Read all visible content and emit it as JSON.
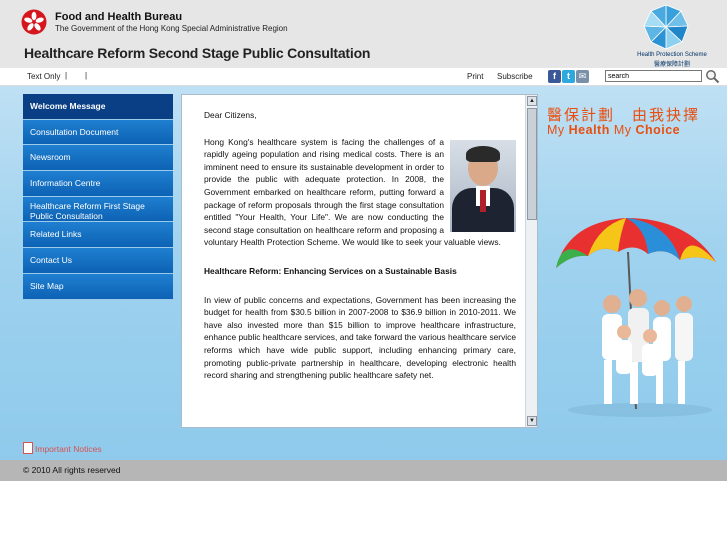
{
  "header": {
    "bureau_name": "Food and Health Bureau",
    "bureau_subtitle": "The Government of the Hong Kong Special Administrative Region",
    "page_title": "Healthcare Reform Second Stage Public Consultation",
    "scheme_name_en": "Health Protection Scheme",
    "scheme_name_zh": "醫療保障計劃"
  },
  "utility": {
    "text_only": "Text Only",
    "separator": "|",
    "print": "Print",
    "subscribe": "Subscribe",
    "search_value": "search",
    "social_icons": [
      "facebook-icon",
      "twitter-icon",
      "email-icon"
    ]
  },
  "nav": {
    "items": [
      {
        "label": "Welcome Message",
        "active": true
      },
      {
        "label": "Consultation Document"
      },
      {
        "label": "Newsroom"
      },
      {
        "label": "Information Centre"
      },
      {
        "label": "Healthcare Reform First Stage Public Consultation"
      },
      {
        "label": "Related Links"
      },
      {
        "label": "Contact Us"
      },
      {
        "label": "Site Map"
      }
    ]
  },
  "content": {
    "greeting": "Dear Citizens,",
    "para1": "Hong Kong's healthcare system is facing the challenges of a rapidly ageing population and rising medical costs. There is an imminent need to ensure its sustainable development in order to provide the public with adequate protection. In 2008, the Government embarked on healthcare reform, putting forward a package of reform proposals through the first stage consultation entitled \"Your Health, Your Life\". We are now conducting the second stage consultation on healthcare reform and proposing a voluntary Health Protection Scheme. We would like to seek your valuable views.",
    "subheading": "Healthcare Reform: Enhancing Services on a Sustainable Basis",
    "para2": "In view of public concerns and expectations, Government has been increasing the budget for health from $30.5 billion in 2007-2008 to $36.9 billion in 2010-2011. We have also invested more than $15 billion to improve healthcare infrastructure, enhance public healthcare services, and take forward the various healthcare service reforms which have wide public support, including enhancing primary care, promoting public-private partnership in healthcare, developing electronic health record sharing and strengthening public healthcare safety net."
  },
  "slogan": {
    "zh": "醫保計劃　由我抉擇",
    "en_my1": "My ",
    "en_health": "Health",
    "en_my2": " My ",
    "en_choice": "Choice"
  },
  "notices": "Important Notices",
  "footer": "© 2010 All rights reserved",
  "colors": {
    "nav_blue": "#0d62b4",
    "nav_active": "#0a3f85",
    "slogan_orange": "#e94e0f",
    "background_blue": "#9fd2ee"
  }
}
